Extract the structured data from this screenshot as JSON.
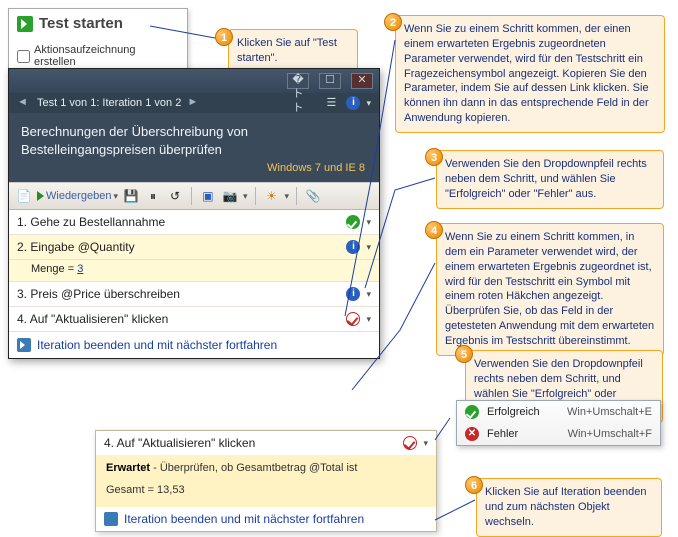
{
  "start_panel": {
    "title": "Test starten",
    "checkbox_label": "Aktionsaufzeichnung erstellen"
  },
  "callouts": {
    "c1": "Klicken Sie auf \"Test starten\".",
    "c2": "Wenn Sie zu einem Schritt kommen, der einen einem erwarteten Ergebnis zugeordneten Parameter verwendet, wird für den Testschritt ein Fragezeichensymbol angezeigt. Kopieren Sie den Parameter, indem Sie auf dessen Link klicken. Sie können ihn dann in das entsprechende Feld in der Anwendung kopieren.",
    "c3": "Verwenden Sie den Dropdownpfeil rechts neben dem Schritt, und wählen Sie \"Erfolgreich\" oder \"Fehler\" aus.",
    "c4": "Wenn Sie zu einem Schritt kommen, in dem ein Parameter verwendet wird, der einem erwarteten Ergebnis zugeordnet ist, wird für den Testschritt ein Symbol mit einem roten Häkchen angezeigt. Überprüfen Sie, ob das Feld in der getesteten Anwendung mit dem erwarteten Ergebnis im Testschritt übereinstimmt.",
    "c5": "Verwenden Sie den Dropdownpfeil rechts neben dem Schritt, und wählen Sie \"Erfolgreich\" oder \"Fehler\" aus.",
    "c6": "Klicken Sie auf Iteration beenden und zum nächsten Objekt wechseln."
  },
  "runner": {
    "iteration_label": "Test 1 von 1: Iteration 1 von 2",
    "heading": "Berechnungen der Überschreibung von Bestelleingangspreisen überprüfen",
    "env": "Windows 7 und IE 8",
    "toolbar": {
      "play": "Wiedergeben"
    },
    "steps": [
      {
        "n": "1.",
        "text": "Gehe zu Bestellannahme"
      },
      {
        "n": "2.",
        "text": "Eingabe @Quantity",
        "sub_label": "Menge =",
        "sub_value": "3"
      },
      {
        "n": "3.",
        "text": "Preis @Price überschreiben"
      },
      {
        "n": "4.",
        "text": "Auf \"Aktualisieren\" klicken"
      }
    ],
    "iter_link": "Iteration beenden und mit nächster fortfahren"
  },
  "expanded": {
    "title": "4. Auf \"Aktualisieren\" klicken",
    "expected_label": "Erwartet",
    "expected_text": "Überprüfen, ob Gesamtbetrag @Total ist",
    "result_line": "Gesamt = 13,53",
    "iter_link": "Iteration beenden und mit nächster fortfahren"
  },
  "menu": {
    "pass_label": "Erfolgreich",
    "pass_shortcut": "Win+Umschalt+E",
    "fail_label": "Fehler",
    "fail_shortcut": "Win+Umschalt+F"
  }
}
